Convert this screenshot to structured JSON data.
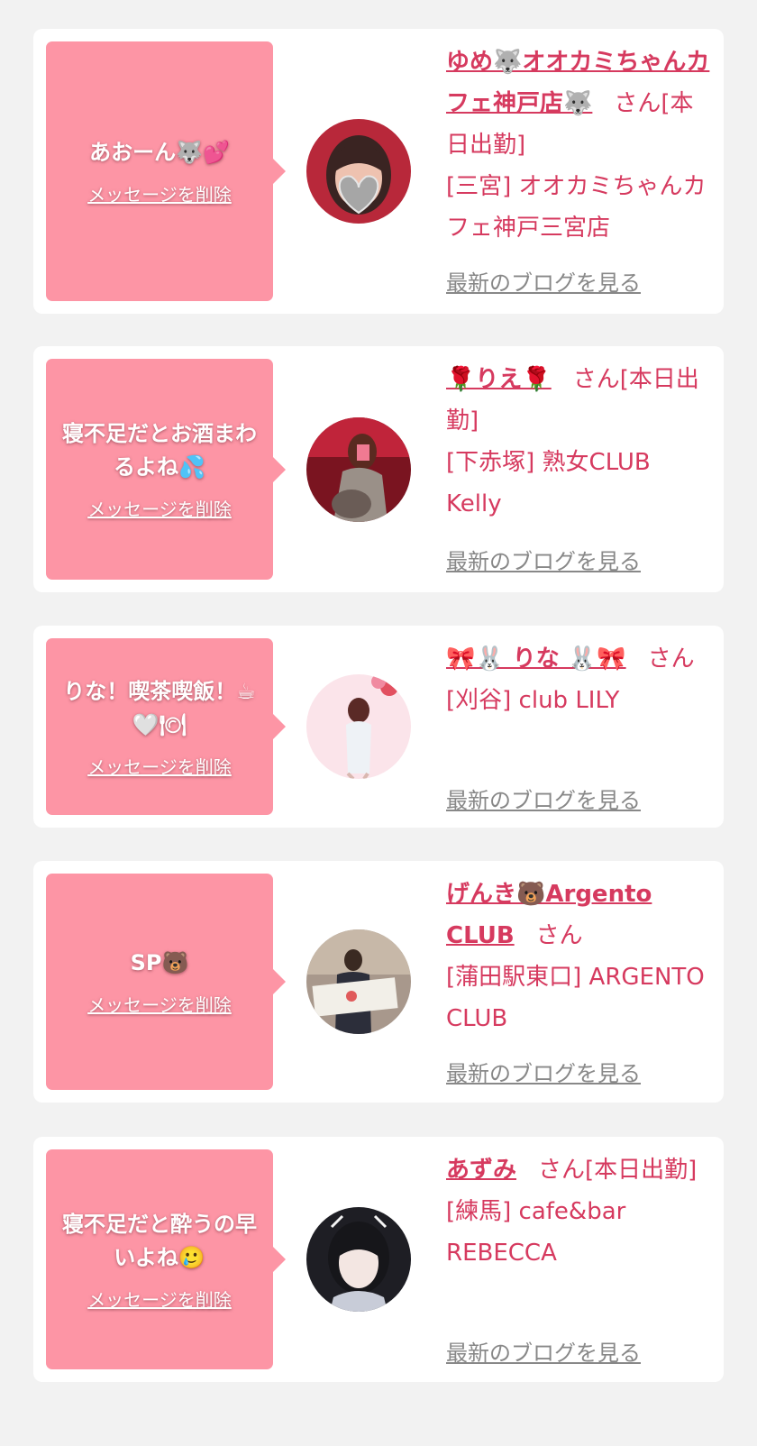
{
  "cards": [
    {
      "message": "あおーん🐺💕",
      "delete_label": "メッセージを削除",
      "name": "ゆめ🐺オオカミちゃんカフェ神戸店🐺",
      "name_suffix": "さん[本日出勤]",
      "shop": "[三宮] オオカミちゃんカフェ神戸三宮店",
      "blog_label": "最新のブログを見る",
      "avatar_icon": "profile-photo"
    },
    {
      "message": "寝不足だとお酒まわるよね💦",
      "delete_label": "メッセージを削除",
      "name": "🌹りえ🌹",
      "name_suffix": "さん[本日出勤]",
      "shop": "[下赤塚] 熟女CLUB Kelly",
      "blog_label": "最新のブログを見る",
      "avatar_icon": "profile-photo"
    },
    {
      "message": "りな！喫茶喫飯！☕🤍🍽",
      "delete_label": "メッセージを削除",
      "name": "🎀🐰 りな 🐰🎀",
      "name_suffix": "さん",
      "shop": "[刈谷] club LILY",
      "blog_label": "最新のブログを見る",
      "avatar_icon": "profile-photo"
    },
    {
      "message": "SP🐻",
      "delete_label": "メッセージを削除",
      "name": "げんき🐻Argento CLUB",
      "name_suffix": "さん",
      "shop": "[蒲田駅東口] ARGENTO CLUB",
      "blog_label": "最新のブログを見る",
      "avatar_icon": "profile-photo"
    },
    {
      "message": "寝不足だと酔うの早いよね🥲",
      "delete_label": "メッセージを削除",
      "name": "あずみ",
      "name_suffix": "さん[本日出勤]",
      "shop": "[練馬] cafe&bar REBECCA",
      "blog_label": "最新のブログを見る",
      "avatar_icon": "profile-photo"
    }
  ],
  "colors": {
    "page_bg": "#f2f2f2",
    "card_bg": "#ffffff",
    "bubble_bg": "#fd95a5",
    "accent_text": "#d63a5f",
    "muted_link": "#888888"
  }
}
